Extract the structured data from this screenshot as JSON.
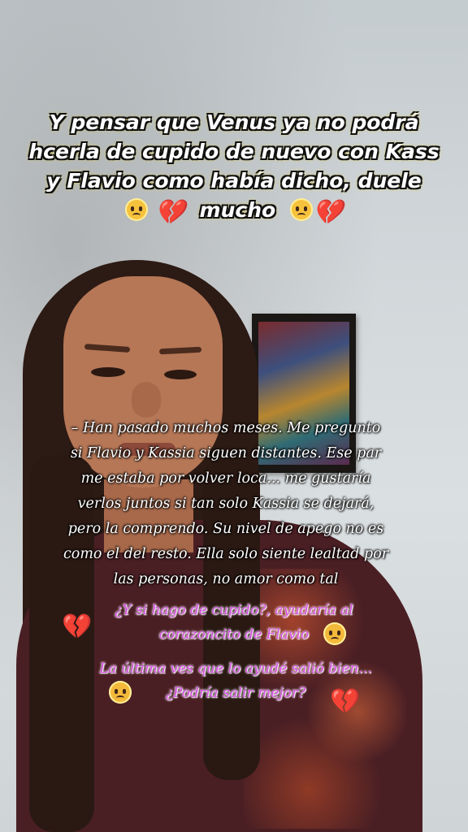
{
  "caption": {
    "line1": "Y pensar que Venus ya no podrá",
    "line2": "hcerla de cupido de nuevo con Kass",
    "line3": "y Flavio como había dicho, duele",
    "line4_word": "mucho"
  },
  "story": {
    "lines": [
      "– Han pasado muchos meses. Me  pregunto",
      "si Flavio y Kassia siguen  distantes. Ese par",
      "me estaba por volver loca... me gustaría",
      "verlos juntos si tan solo Kassia  se dejará,",
      "pero la comprendo. Su nivel de apego no es",
      "como el del resto. Ella solo siente lealtad por",
      "las personas, no amor como tal"
    ]
  },
  "thoughts": {
    "q1_line1": "¿Y si hago de cupido?, ayudaría al",
    "q1_line2": "corazoncito de Flavio",
    "q2_line1": "La última ves que lo ayudé salió bien...",
    "q2_line2": "¿Podría salir mejor?"
  },
  "icons": [
    "pleading-face-emoji",
    "broken-heart-emoji",
    "loudly-crying-face-emoji"
  ],
  "colors": {
    "caption_glow": "#f2d21b",
    "thought_text": "#d64fe3",
    "heart": "#d0152a"
  }
}
